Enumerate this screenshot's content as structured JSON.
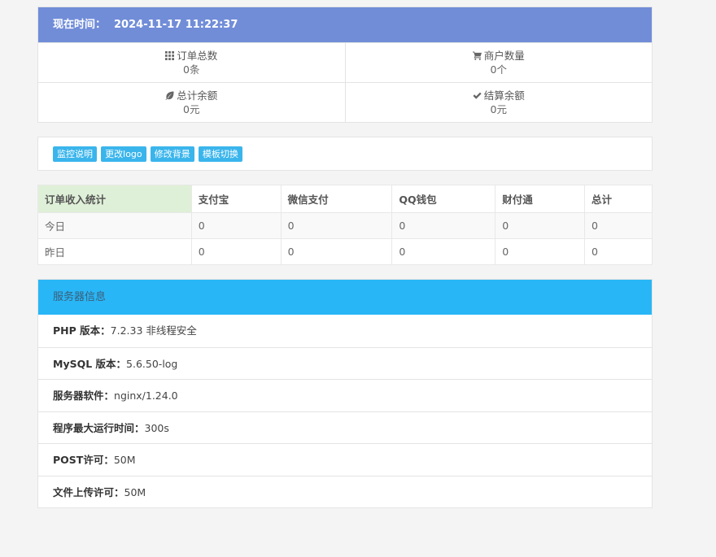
{
  "time": {
    "label": "现在时间：",
    "value": "2024-11-17 11:22:37"
  },
  "stats": [
    {
      "icon": "grid-icon",
      "title": "订单总数",
      "value": "0条"
    },
    {
      "icon": "cart-icon",
      "title": "商户数量",
      "value": "0个"
    },
    {
      "icon": "leaf-icon",
      "title": "总计余额",
      "value": "0元"
    },
    {
      "icon": "check-icon",
      "title": "结算余额",
      "value": "0元"
    }
  ],
  "buttons": [
    "监控说明",
    "更改logo",
    "修改背景",
    "模板切换"
  ],
  "income": {
    "headers": [
      "订单收入统计",
      "支付宝",
      "微信支付",
      "QQ钱包",
      "财付通",
      "总计"
    ],
    "rows": [
      [
        "今日",
        "0",
        "0",
        "0",
        "0",
        "0"
      ],
      [
        "昨日",
        "0",
        "0",
        "0",
        "0",
        "0"
      ]
    ]
  },
  "server": {
    "title": "服务器信息",
    "items": [
      {
        "key": "PHP 版本：",
        "value": "7.2.33 非线程安全"
      },
      {
        "key": "MySQL 版本：",
        "value": "5.6.50-log"
      },
      {
        "key": "服务器软件：",
        "value": "nginx/1.24.0"
      },
      {
        "key": "程序最大运行时间：",
        "value": "300s"
      },
      {
        "key": "POST许可：",
        "value": "50M"
      },
      {
        "key": "文件上传许可：",
        "value": "50M"
      }
    ]
  },
  "colors": {
    "time_header": "#718dd8",
    "server_header": "#29b6f6",
    "button": "#3ab5ec",
    "first_header_cell": "#dff0d8"
  }
}
